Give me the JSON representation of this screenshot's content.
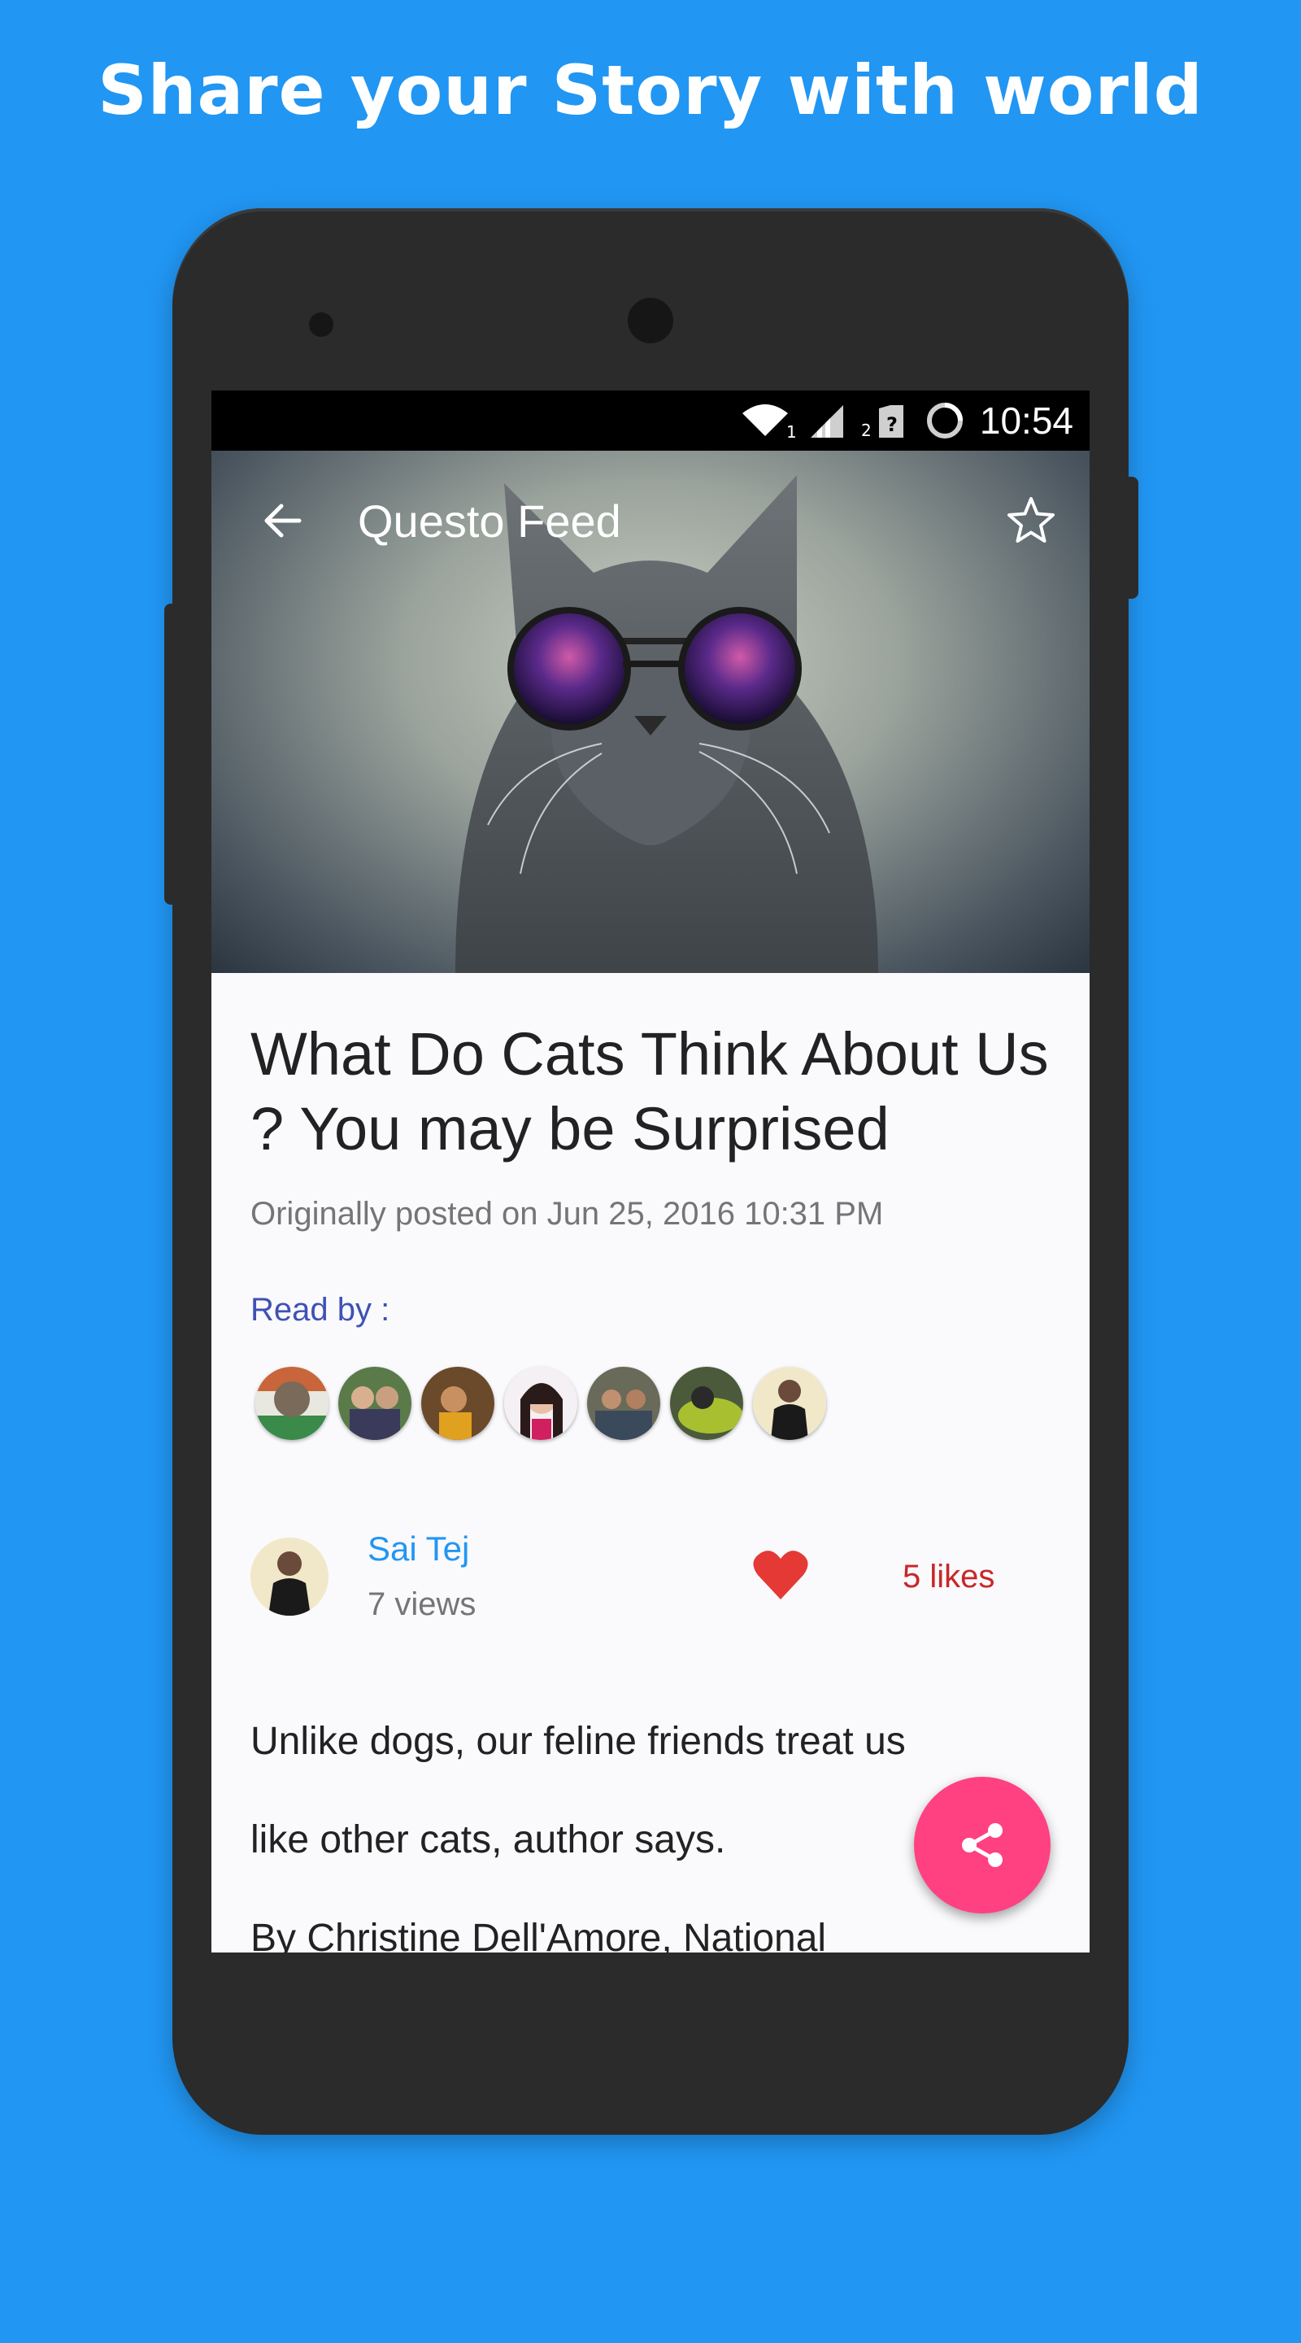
{
  "promo": {
    "headline": "Share your Story with world"
  },
  "status_bar": {
    "time": "10:54",
    "icons": [
      "wifi-icon",
      "signal-icon",
      "sim-icon",
      "sync-icon"
    ],
    "wifi_sub": "1",
    "sim_sub": "2"
  },
  "toolbar": {
    "title": "Questo Feed",
    "back_icon": "arrow-left-icon",
    "star_icon": "star-outline-icon"
  },
  "article": {
    "title": "What Do Cats Think About Us ? You may be Surprised",
    "posted": "Originally posted on Jun 25, 2016 10:31 PM",
    "read_by_label": "Read by :",
    "reader_count": 7,
    "author": {
      "name": "Sai Tej",
      "views": "7 views"
    },
    "likes": "5 likes",
    "body": [
      "Unlike dogs, our feline friends treat us",
      "like other cats, author says.",
      "By Christine Dell'Amore, National"
    ]
  },
  "fab": {
    "icon": "share-icon"
  },
  "colors": {
    "background": "#2196F3",
    "accent": "#ff4081",
    "link": "#2196F3",
    "read_by": "#3f51b5",
    "likes": "#c62828",
    "heart": "#e53935"
  }
}
